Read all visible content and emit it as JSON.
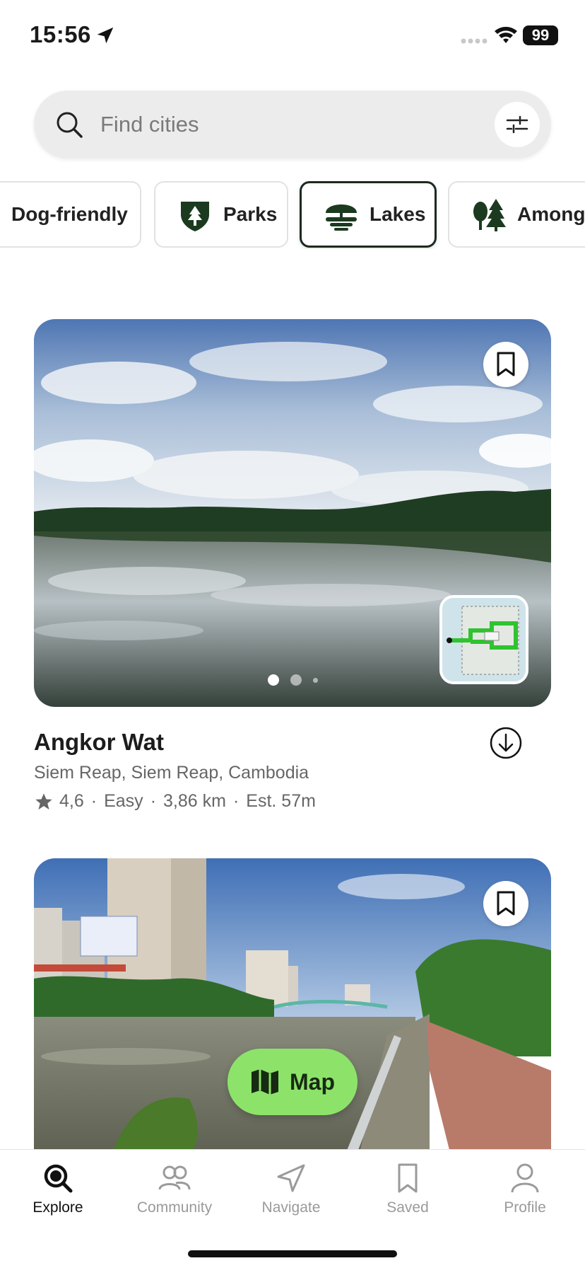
{
  "status_bar": {
    "time": "15:56",
    "battery": "99"
  },
  "search": {
    "placeholder": "Find cities"
  },
  "chips": [
    {
      "label": "Dog-friendly",
      "active": false
    },
    {
      "label": "Parks",
      "active": false
    },
    {
      "label": "Lakes",
      "active": true
    },
    {
      "label": "Among",
      "active": false
    }
  ],
  "cards": [
    {
      "title": "Angkor Wat",
      "location": "Siem Reap, Siem Reap, Cambodia",
      "rating": "4,6",
      "difficulty": "Easy",
      "distance": "3,86 km",
      "estimate": "Est. 57m",
      "photo_count": 3,
      "active_photo": 1
    }
  ],
  "map_button": {
    "label": "Map"
  },
  "tabs": [
    {
      "label": "Explore",
      "icon": "search-icon",
      "active": true
    },
    {
      "label": "Community",
      "icon": "people-icon",
      "active": false
    },
    {
      "label": "Navigate",
      "icon": "navigate-icon",
      "active": false
    },
    {
      "label": "Saved",
      "icon": "bookmark-icon",
      "active": false
    },
    {
      "label": "Profile",
      "icon": "person-icon",
      "active": false
    }
  ],
  "colors": {
    "accent_green": "#8de36a",
    "dark_green": "#1c3a1f",
    "inactive_gray": "#9a9a9a"
  }
}
